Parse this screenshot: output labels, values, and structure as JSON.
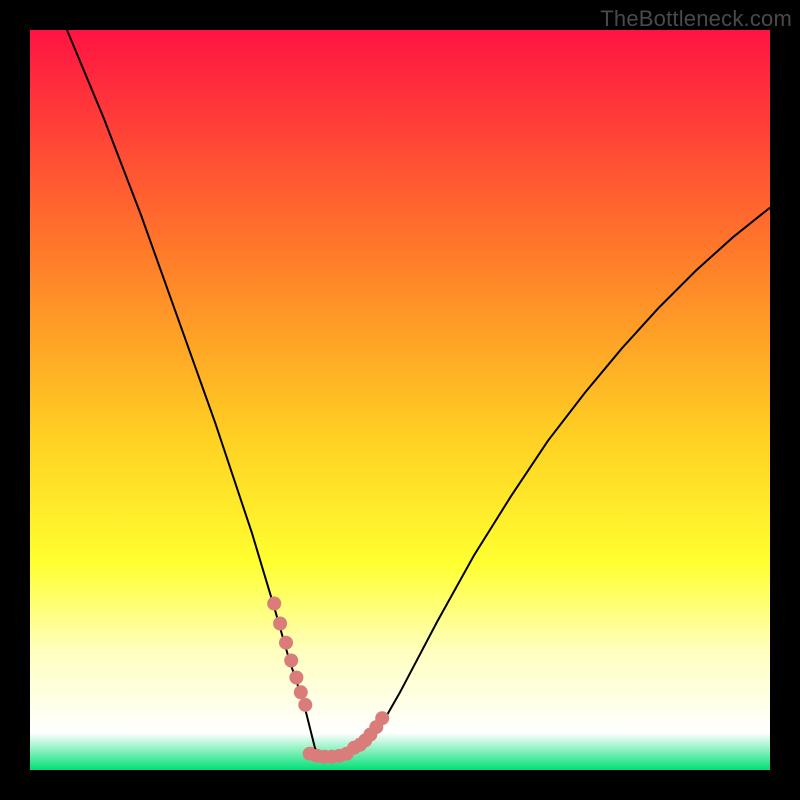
{
  "watermark": "TheBottleneck.com",
  "chart_data": {
    "type": "line",
    "title": "",
    "xlabel": "",
    "ylabel": "",
    "xlim": [
      0,
      100
    ],
    "ylim": [
      0,
      100
    ],
    "series": [
      {
        "name": "bottleneck-curve",
        "x": [
          5,
          10,
          15,
          20,
          25,
          30,
          33,
          35,
          37,
          38,
          38.5,
          39,
          40,
          42,
          44,
          46,
          48,
          50,
          55,
          60,
          65,
          70,
          75,
          80,
          85,
          90,
          95,
          100
        ],
        "values": [
          100,
          88,
          75,
          61,
          47,
          32,
          22,
          15,
          9,
          5,
          3,
          2,
          2,
          2,
          3,
          4.5,
          7,
          10.5,
          20,
          29,
          37,
          44.5,
          51,
          57,
          62.5,
          67.5,
          72,
          76
        ]
      },
      {
        "name": "marker-cluster-left",
        "x": [
          33.0,
          33.8,
          34.6,
          35.3,
          36.0,
          36.6,
          37.2
        ],
        "values": [
          22.5,
          19.8,
          17.2,
          14.8,
          12.5,
          10.5,
          8.8
        ]
      },
      {
        "name": "marker-cluster-right",
        "x": [
          43.8,
          44.6,
          45.3,
          46.0,
          46.8,
          47.6
        ],
        "values": [
          3.0,
          3.4,
          4.0,
          4.8,
          5.8,
          7.0
        ]
      },
      {
        "name": "marker-cluster-bottom",
        "x": [
          37.8,
          38.8,
          39.8,
          40.8,
          41.8,
          42.8
        ],
        "values": [
          2.2,
          1.9,
          1.8,
          1.8,
          1.9,
          2.2
        ]
      }
    ],
    "colors": {
      "gradient_top": "#ff1342",
      "gradient_mid_upper": "#ff7a2a",
      "gradient_mid": "#ffd023",
      "gradient_mid_lower": "#ffff30",
      "gradient_pale": "#ffffc0",
      "gradient_bottom": "#00e076",
      "curve": "#000000",
      "markers": "#da7c7a",
      "frame": "#000000",
      "watermark": "#4a4a4a"
    }
  }
}
